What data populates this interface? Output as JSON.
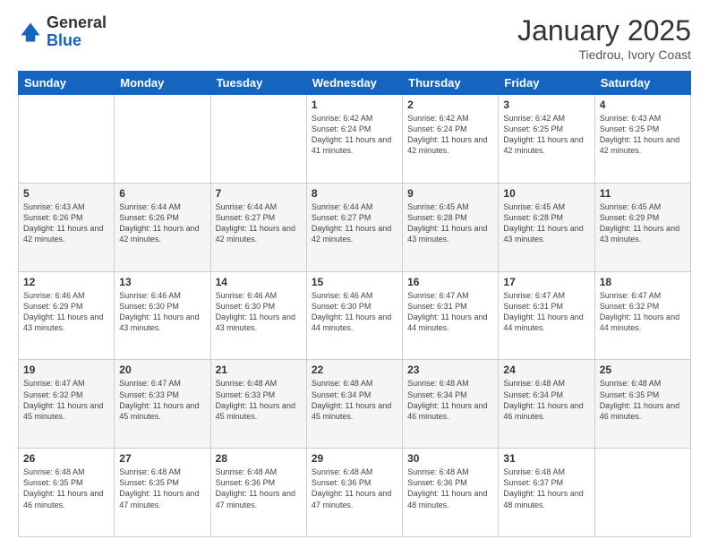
{
  "header": {
    "logo_general": "General",
    "logo_blue": "Blue",
    "title": "January 2025",
    "subtitle": "Tiedrou, Ivory Coast"
  },
  "weekdays": [
    "Sunday",
    "Monday",
    "Tuesday",
    "Wednesday",
    "Thursday",
    "Friday",
    "Saturday"
  ],
  "weeks": [
    [
      {
        "day": "",
        "sunrise": "",
        "sunset": "",
        "daylight": ""
      },
      {
        "day": "",
        "sunrise": "",
        "sunset": "",
        "daylight": ""
      },
      {
        "day": "",
        "sunrise": "",
        "sunset": "",
        "daylight": ""
      },
      {
        "day": "1",
        "sunrise": "Sunrise: 6:42 AM",
        "sunset": "Sunset: 6:24 PM",
        "daylight": "Daylight: 11 hours and 41 minutes."
      },
      {
        "day": "2",
        "sunrise": "Sunrise: 6:42 AM",
        "sunset": "Sunset: 6:24 PM",
        "daylight": "Daylight: 11 hours and 42 minutes."
      },
      {
        "day": "3",
        "sunrise": "Sunrise: 6:42 AM",
        "sunset": "Sunset: 6:25 PM",
        "daylight": "Daylight: 11 hours and 42 minutes."
      },
      {
        "day": "4",
        "sunrise": "Sunrise: 6:43 AM",
        "sunset": "Sunset: 6:25 PM",
        "daylight": "Daylight: 11 hours and 42 minutes."
      }
    ],
    [
      {
        "day": "5",
        "sunrise": "Sunrise: 6:43 AM",
        "sunset": "Sunset: 6:26 PM",
        "daylight": "Daylight: 11 hours and 42 minutes."
      },
      {
        "day": "6",
        "sunrise": "Sunrise: 6:44 AM",
        "sunset": "Sunset: 6:26 PM",
        "daylight": "Daylight: 11 hours and 42 minutes."
      },
      {
        "day": "7",
        "sunrise": "Sunrise: 6:44 AM",
        "sunset": "Sunset: 6:27 PM",
        "daylight": "Daylight: 11 hours and 42 minutes."
      },
      {
        "day": "8",
        "sunrise": "Sunrise: 6:44 AM",
        "sunset": "Sunset: 6:27 PM",
        "daylight": "Daylight: 11 hours and 42 minutes."
      },
      {
        "day": "9",
        "sunrise": "Sunrise: 6:45 AM",
        "sunset": "Sunset: 6:28 PM",
        "daylight": "Daylight: 11 hours and 43 minutes."
      },
      {
        "day": "10",
        "sunrise": "Sunrise: 6:45 AM",
        "sunset": "Sunset: 6:28 PM",
        "daylight": "Daylight: 11 hours and 43 minutes."
      },
      {
        "day": "11",
        "sunrise": "Sunrise: 6:45 AM",
        "sunset": "Sunset: 6:29 PM",
        "daylight": "Daylight: 11 hours and 43 minutes."
      }
    ],
    [
      {
        "day": "12",
        "sunrise": "Sunrise: 6:46 AM",
        "sunset": "Sunset: 6:29 PM",
        "daylight": "Daylight: 11 hours and 43 minutes."
      },
      {
        "day": "13",
        "sunrise": "Sunrise: 6:46 AM",
        "sunset": "Sunset: 6:30 PM",
        "daylight": "Daylight: 11 hours and 43 minutes."
      },
      {
        "day": "14",
        "sunrise": "Sunrise: 6:46 AM",
        "sunset": "Sunset: 6:30 PM",
        "daylight": "Daylight: 11 hours and 43 minutes."
      },
      {
        "day": "15",
        "sunrise": "Sunrise: 6:46 AM",
        "sunset": "Sunset: 6:30 PM",
        "daylight": "Daylight: 11 hours and 44 minutes."
      },
      {
        "day": "16",
        "sunrise": "Sunrise: 6:47 AM",
        "sunset": "Sunset: 6:31 PM",
        "daylight": "Daylight: 11 hours and 44 minutes."
      },
      {
        "day": "17",
        "sunrise": "Sunrise: 6:47 AM",
        "sunset": "Sunset: 6:31 PM",
        "daylight": "Daylight: 11 hours and 44 minutes."
      },
      {
        "day": "18",
        "sunrise": "Sunrise: 6:47 AM",
        "sunset": "Sunset: 6:32 PM",
        "daylight": "Daylight: 11 hours and 44 minutes."
      }
    ],
    [
      {
        "day": "19",
        "sunrise": "Sunrise: 6:47 AM",
        "sunset": "Sunset: 6:32 PM",
        "daylight": "Daylight: 11 hours and 45 minutes."
      },
      {
        "day": "20",
        "sunrise": "Sunrise: 6:47 AM",
        "sunset": "Sunset: 6:33 PM",
        "daylight": "Daylight: 11 hours and 45 minutes."
      },
      {
        "day": "21",
        "sunrise": "Sunrise: 6:48 AM",
        "sunset": "Sunset: 6:33 PM",
        "daylight": "Daylight: 11 hours and 45 minutes."
      },
      {
        "day": "22",
        "sunrise": "Sunrise: 6:48 AM",
        "sunset": "Sunset: 6:34 PM",
        "daylight": "Daylight: 11 hours and 45 minutes."
      },
      {
        "day": "23",
        "sunrise": "Sunrise: 6:48 AM",
        "sunset": "Sunset: 6:34 PM",
        "daylight": "Daylight: 11 hours and 46 minutes."
      },
      {
        "day": "24",
        "sunrise": "Sunrise: 6:48 AM",
        "sunset": "Sunset: 6:34 PM",
        "daylight": "Daylight: 11 hours and 46 minutes."
      },
      {
        "day": "25",
        "sunrise": "Sunrise: 6:48 AM",
        "sunset": "Sunset: 6:35 PM",
        "daylight": "Daylight: 11 hours and 46 minutes."
      }
    ],
    [
      {
        "day": "26",
        "sunrise": "Sunrise: 6:48 AM",
        "sunset": "Sunset: 6:35 PM",
        "daylight": "Daylight: 11 hours and 46 minutes."
      },
      {
        "day": "27",
        "sunrise": "Sunrise: 6:48 AM",
        "sunset": "Sunset: 6:35 PM",
        "daylight": "Daylight: 11 hours and 47 minutes."
      },
      {
        "day": "28",
        "sunrise": "Sunrise: 6:48 AM",
        "sunset": "Sunset: 6:36 PM",
        "daylight": "Daylight: 11 hours and 47 minutes."
      },
      {
        "day": "29",
        "sunrise": "Sunrise: 6:48 AM",
        "sunset": "Sunset: 6:36 PM",
        "daylight": "Daylight: 11 hours and 47 minutes."
      },
      {
        "day": "30",
        "sunrise": "Sunrise: 6:48 AM",
        "sunset": "Sunset: 6:36 PM",
        "daylight": "Daylight: 11 hours and 48 minutes."
      },
      {
        "day": "31",
        "sunrise": "Sunrise: 6:48 AM",
        "sunset": "Sunset: 6:37 PM",
        "daylight": "Daylight: 11 hours and 48 minutes."
      },
      {
        "day": "",
        "sunrise": "",
        "sunset": "",
        "daylight": ""
      }
    ]
  ]
}
